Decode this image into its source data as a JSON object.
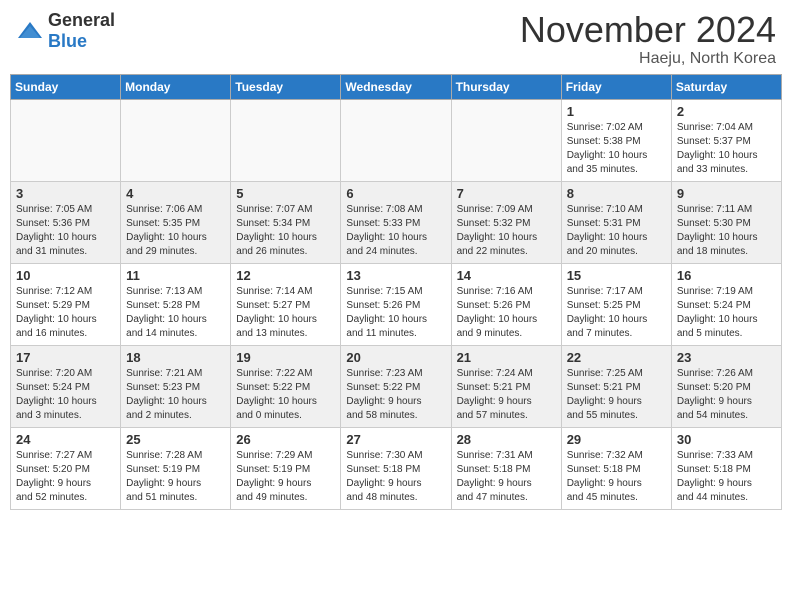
{
  "header": {
    "logo_general": "General",
    "logo_blue": "Blue",
    "month_title": "November 2024",
    "location": "Haeju, North Korea"
  },
  "weekdays": [
    "Sunday",
    "Monday",
    "Tuesday",
    "Wednesday",
    "Thursday",
    "Friday",
    "Saturday"
  ],
  "weeks": [
    [
      {
        "day": "",
        "detail": ""
      },
      {
        "day": "",
        "detail": ""
      },
      {
        "day": "",
        "detail": ""
      },
      {
        "day": "",
        "detail": ""
      },
      {
        "day": "",
        "detail": ""
      },
      {
        "day": "1",
        "detail": "Sunrise: 7:02 AM\nSunset: 5:38 PM\nDaylight: 10 hours\nand 35 minutes."
      },
      {
        "day": "2",
        "detail": "Sunrise: 7:04 AM\nSunset: 5:37 PM\nDaylight: 10 hours\nand 33 minutes."
      }
    ],
    [
      {
        "day": "3",
        "detail": "Sunrise: 7:05 AM\nSunset: 5:36 PM\nDaylight: 10 hours\nand 31 minutes."
      },
      {
        "day": "4",
        "detail": "Sunrise: 7:06 AM\nSunset: 5:35 PM\nDaylight: 10 hours\nand 29 minutes."
      },
      {
        "day": "5",
        "detail": "Sunrise: 7:07 AM\nSunset: 5:34 PM\nDaylight: 10 hours\nand 26 minutes."
      },
      {
        "day": "6",
        "detail": "Sunrise: 7:08 AM\nSunset: 5:33 PM\nDaylight: 10 hours\nand 24 minutes."
      },
      {
        "day": "7",
        "detail": "Sunrise: 7:09 AM\nSunset: 5:32 PM\nDaylight: 10 hours\nand 22 minutes."
      },
      {
        "day": "8",
        "detail": "Sunrise: 7:10 AM\nSunset: 5:31 PM\nDaylight: 10 hours\nand 20 minutes."
      },
      {
        "day": "9",
        "detail": "Sunrise: 7:11 AM\nSunset: 5:30 PM\nDaylight: 10 hours\nand 18 minutes."
      }
    ],
    [
      {
        "day": "10",
        "detail": "Sunrise: 7:12 AM\nSunset: 5:29 PM\nDaylight: 10 hours\nand 16 minutes."
      },
      {
        "day": "11",
        "detail": "Sunrise: 7:13 AM\nSunset: 5:28 PM\nDaylight: 10 hours\nand 14 minutes."
      },
      {
        "day": "12",
        "detail": "Sunrise: 7:14 AM\nSunset: 5:27 PM\nDaylight: 10 hours\nand 13 minutes."
      },
      {
        "day": "13",
        "detail": "Sunrise: 7:15 AM\nSunset: 5:26 PM\nDaylight: 10 hours\nand 11 minutes."
      },
      {
        "day": "14",
        "detail": "Sunrise: 7:16 AM\nSunset: 5:26 PM\nDaylight: 10 hours\nand 9 minutes."
      },
      {
        "day": "15",
        "detail": "Sunrise: 7:17 AM\nSunset: 5:25 PM\nDaylight: 10 hours\nand 7 minutes."
      },
      {
        "day": "16",
        "detail": "Sunrise: 7:19 AM\nSunset: 5:24 PM\nDaylight: 10 hours\nand 5 minutes."
      }
    ],
    [
      {
        "day": "17",
        "detail": "Sunrise: 7:20 AM\nSunset: 5:24 PM\nDaylight: 10 hours\nand 3 minutes."
      },
      {
        "day": "18",
        "detail": "Sunrise: 7:21 AM\nSunset: 5:23 PM\nDaylight: 10 hours\nand 2 minutes."
      },
      {
        "day": "19",
        "detail": "Sunrise: 7:22 AM\nSunset: 5:22 PM\nDaylight: 10 hours\nand 0 minutes."
      },
      {
        "day": "20",
        "detail": "Sunrise: 7:23 AM\nSunset: 5:22 PM\nDaylight: 9 hours\nand 58 minutes."
      },
      {
        "day": "21",
        "detail": "Sunrise: 7:24 AM\nSunset: 5:21 PM\nDaylight: 9 hours\nand 57 minutes."
      },
      {
        "day": "22",
        "detail": "Sunrise: 7:25 AM\nSunset: 5:21 PM\nDaylight: 9 hours\nand 55 minutes."
      },
      {
        "day": "23",
        "detail": "Sunrise: 7:26 AM\nSunset: 5:20 PM\nDaylight: 9 hours\nand 54 minutes."
      }
    ],
    [
      {
        "day": "24",
        "detail": "Sunrise: 7:27 AM\nSunset: 5:20 PM\nDaylight: 9 hours\nand 52 minutes."
      },
      {
        "day": "25",
        "detail": "Sunrise: 7:28 AM\nSunset: 5:19 PM\nDaylight: 9 hours\nand 51 minutes."
      },
      {
        "day": "26",
        "detail": "Sunrise: 7:29 AM\nSunset: 5:19 PM\nDaylight: 9 hours\nand 49 minutes."
      },
      {
        "day": "27",
        "detail": "Sunrise: 7:30 AM\nSunset: 5:18 PM\nDaylight: 9 hours\nand 48 minutes."
      },
      {
        "day": "28",
        "detail": "Sunrise: 7:31 AM\nSunset: 5:18 PM\nDaylight: 9 hours\nand 47 minutes."
      },
      {
        "day": "29",
        "detail": "Sunrise: 7:32 AM\nSunset: 5:18 PM\nDaylight: 9 hours\nand 45 minutes."
      },
      {
        "day": "30",
        "detail": "Sunrise: 7:33 AM\nSunset: 5:18 PM\nDaylight: 9 hours\nand 44 minutes."
      }
    ]
  ]
}
